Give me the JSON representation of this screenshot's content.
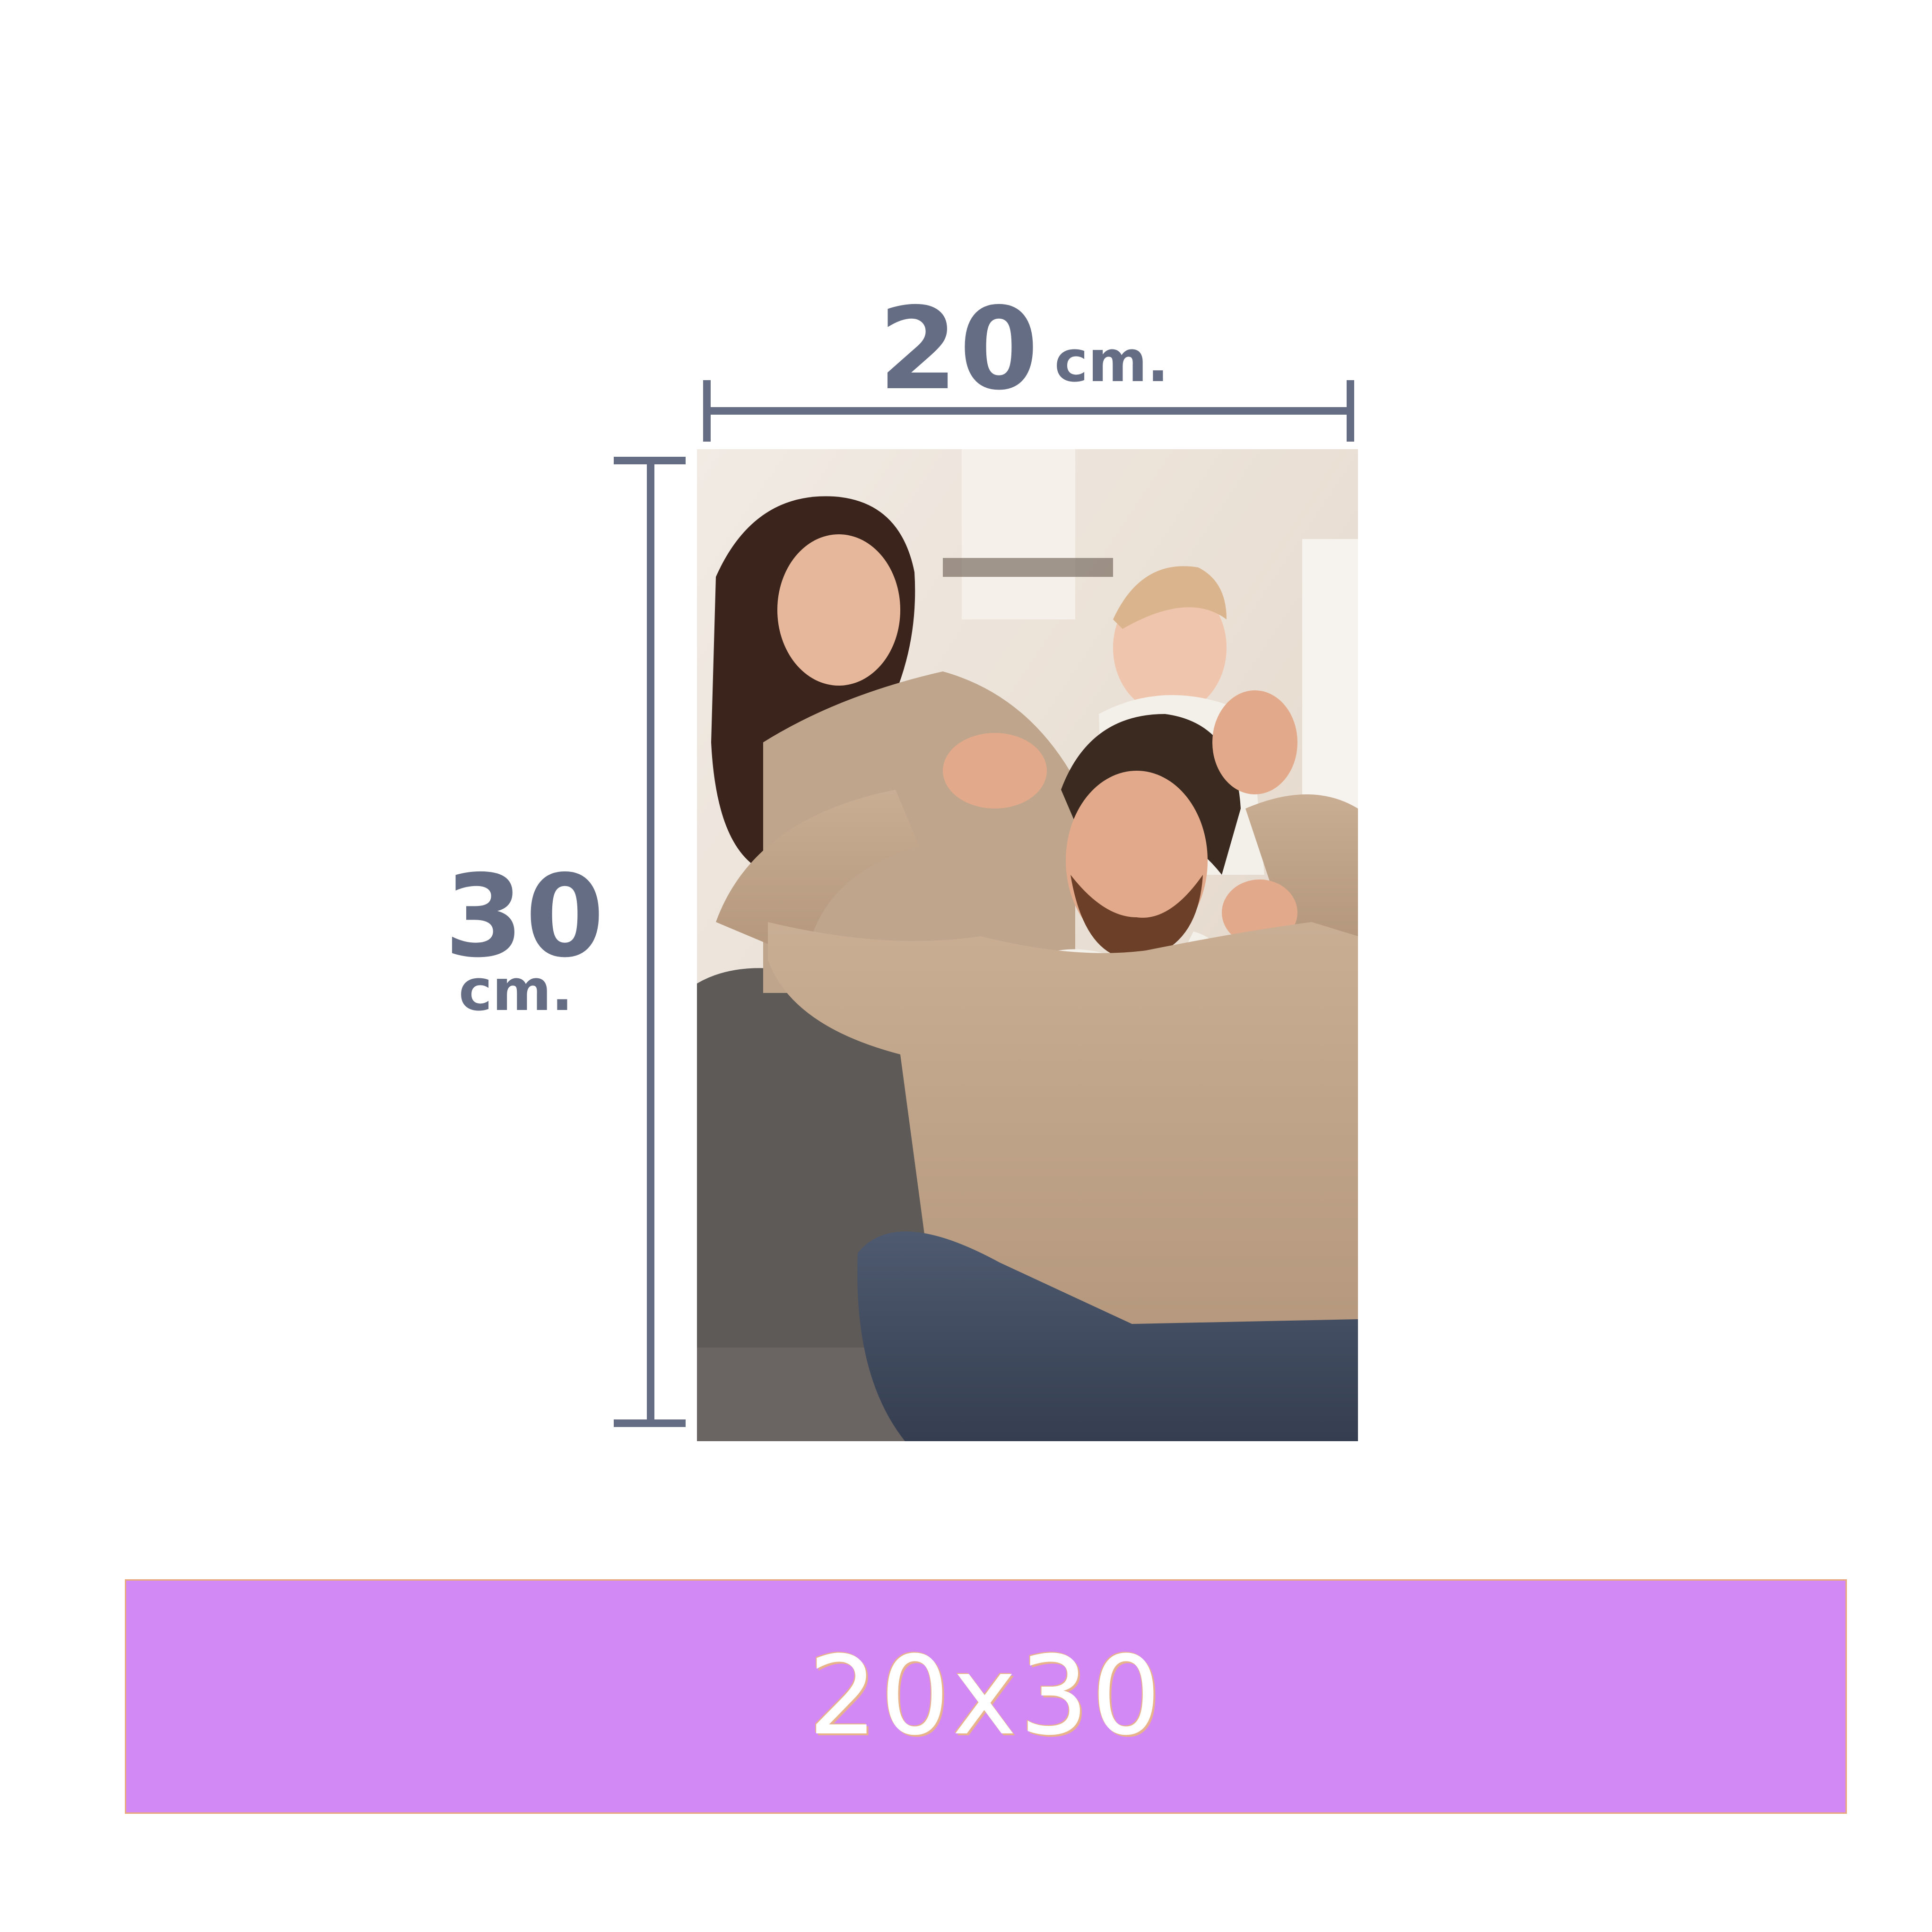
{
  "dimensions": {
    "width": {
      "value": "20",
      "unit": "cm."
    },
    "height": {
      "value": "30",
      "unit": "cm."
    }
  },
  "size_label": "20x30",
  "colors": {
    "dimension_marker": "#656d84",
    "banner_background": "#d389f5",
    "banner_text": "#ffffff",
    "banner_border": "#e8a97f"
  }
}
